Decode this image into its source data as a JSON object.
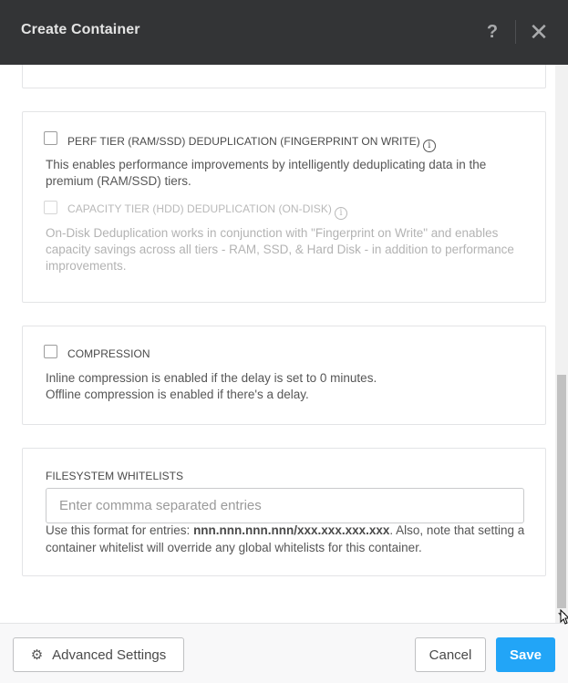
{
  "dialog": {
    "title": "Create Container",
    "help_label": "?",
    "close_label": "✕"
  },
  "dedup": {
    "perf_label": "PERF TIER (RAM/SSD) DEDUPLICATION (FINGERPRINT ON WRITE)",
    "perf_checked": false,
    "perf_desc": "This enables performance improvements by intelligently deduplicating data in the premium (RAM/SSD) tiers.",
    "capacity_label": "CAPACITY TIER (HDD) DEDUPLICATION (ON-DISK)",
    "capacity_checked": false,
    "capacity_disabled": true,
    "capacity_desc": "On-Disk Deduplication works in conjunction with \"Fingerprint on Write\" and enables capacity savings across all tiers - RAM, SSD, & Hard Disk - in addition to performance improvements.",
    "info_glyph": "i"
  },
  "compression": {
    "label": "COMPRESSION",
    "checked": false,
    "desc_line1": "Inline compression is enabled if the delay is set to 0 minutes.",
    "desc_line2": "Offline compression is enabled if there's a delay."
  },
  "whitelist": {
    "label": "FILESYSTEM WHITELISTS",
    "placeholder": "Enter commma separated entries",
    "value": "",
    "help_prefix": "Use this format for entries: ",
    "help_format": "nnn.nnn.nnn.nnn/xxx.xxx.xxx.xxx",
    "help_suffix": ". Also, note that setting a container whitelist will override any global whitelists for this container."
  },
  "footer": {
    "advanced_label": "Advanced Settings",
    "advanced_icon": "gear-icon",
    "gear_glyph": "⚙",
    "cancel_label": "Cancel",
    "save_label": "Save"
  },
  "colors": {
    "header_bg": "#333436",
    "primary": "#22a5f7",
    "border": "#e3e4e6"
  }
}
